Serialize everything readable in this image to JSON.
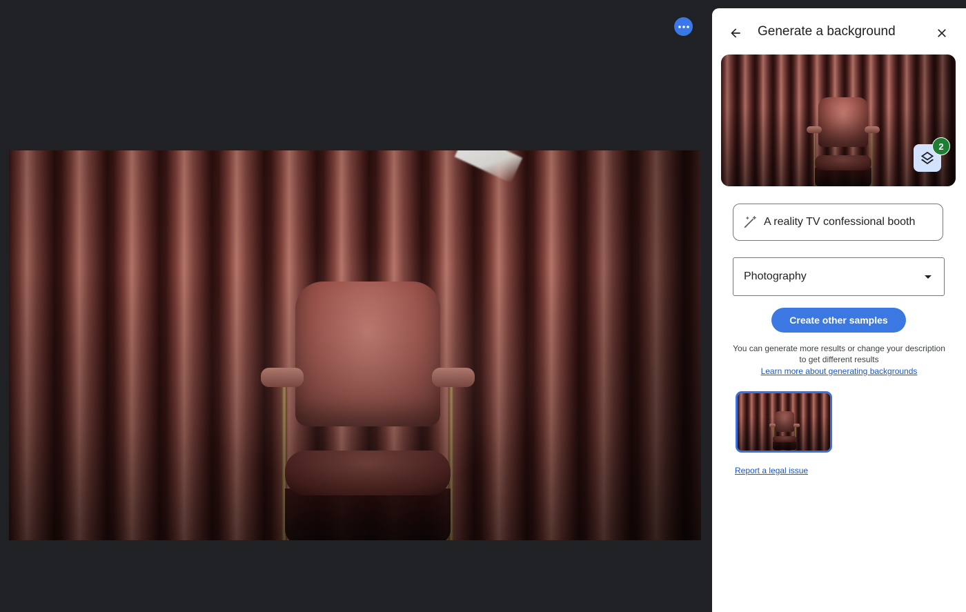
{
  "stage": {
    "more_options_icon": "more-horiz-icon",
    "accent_color": "#3b78e7",
    "image_subject": "chair-in-curtained-booth"
  },
  "panel": {
    "title": "Generate a background",
    "back_icon": "arrow-back-icon",
    "close_icon": "close-icon",
    "preview": {
      "layers_icon": "layers-icon",
      "badge_count": "2",
      "badge_color": "#1e7e34"
    },
    "prompt": {
      "icon": "magic-wand-icon",
      "value": "A reality TV confessional booth"
    },
    "style_select": {
      "value": "Photography"
    },
    "create_button_label": "Create other samples",
    "help_text": "You can generate more results or change your description to get different results",
    "learn_more_link": "Learn more about generating backgrounds",
    "report_link": "Report a legal issue",
    "primary_color": "#3c78e2",
    "link_color": "#1a56c9"
  }
}
